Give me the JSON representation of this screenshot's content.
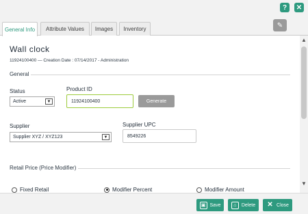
{
  "topbar": {
    "help_icon": "question-icon",
    "close_icon": "close-icon"
  },
  "tabs": [
    {
      "label": "General Info",
      "active": true
    },
    {
      "label": "Attribute Values",
      "active": false
    },
    {
      "label": "Images",
      "active": false
    },
    {
      "label": "Inventory",
      "active": false
    }
  ],
  "product": {
    "title": "Wall  clock",
    "meta": "11924100400  —   Creation Date  :  07/14/2017  -  Administration"
  },
  "general": {
    "section_label": "General",
    "status_label": "Status",
    "status_value": "Active",
    "product_id_label": "Product  ID",
    "product_id_value": "11924100400",
    "generate_label": "Generate",
    "supplier_label": "Supplier",
    "supplier_value": "Supplier XYZ / XYZ123",
    "supplier_upc_label": "Supplier  UPC",
    "supplier_upc_value": "8549226"
  },
  "retail": {
    "section_label": "Retail  Price  (Price  Modifier)",
    "options": [
      {
        "label": "Fixed  Retail",
        "selected": false
      },
      {
        "label": "Modifier  Percent",
        "selected": true
      },
      {
        "label": "Modifier  Amount",
        "selected": false
      }
    ]
  },
  "footer": {
    "save_label": "Save",
    "delete_label": "Delete",
    "close_label": "Close"
  },
  "colors": {
    "accent": "#2e9a7f",
    "focus": "#9ccb3b",
    "neutral_button": "#9a9a9a"
  }
}
